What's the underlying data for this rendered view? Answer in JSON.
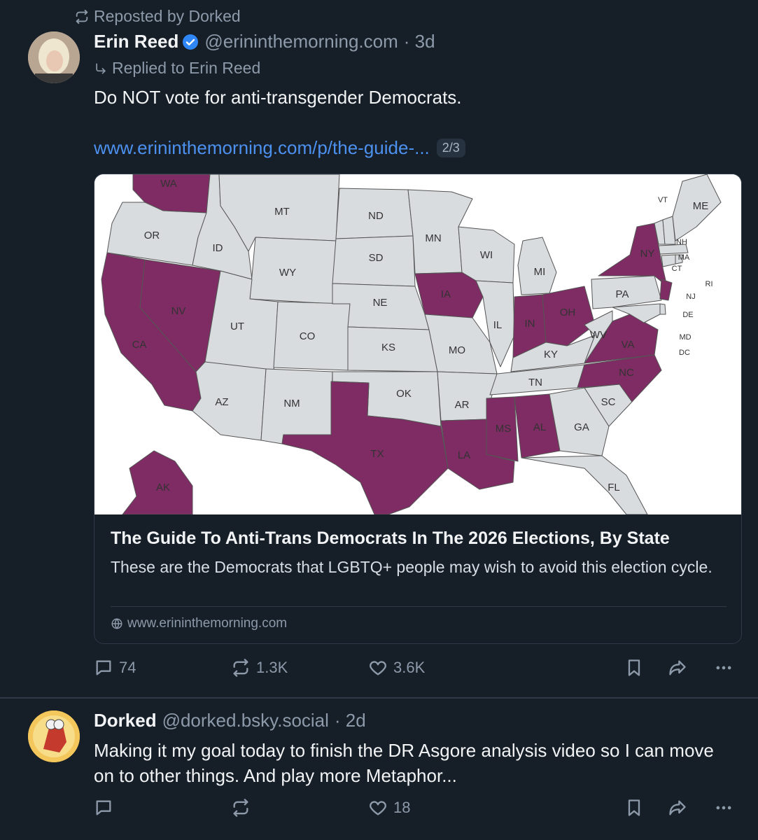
{
  "repost": {
    "label": "Reposted by Dorked"
  },
  "post1": {
    "author": "Erin Reed",
    "handle": "@erininthemorning.com",
    "time": "· 3d",
    "replied_to": "Replied to Erin Reed",
    "text": "Do NOT vote for anti-transgender Democrats.",
    "link": "www.erininthemorning.com/p/the-guide-...",
    "thread_badge": "2/3",
    "card": {
      "title": "The Guide To Anti-Trans Democrats In The 2026 Elections, By State",
      "description": "These are the Democrats that LGBTQ+ people may wish to avoid this election cycle.",
      "domain": "www.erininthemorning.com"
    },
    "replies": "74",
    "reposts": "1.3K",
    "likes": "3.6K"
  },
  "map": {
    "highlight_color": "#7e2c63",
    "base_color": "#d9dcdf",
    "highlighted_states": [
      "WA",
      "CA",
      "NV",
      "IA",
      "IN",
      "OH",
      "NY",
      "NJ",
      "VA",
      "NC",
      "TX",
      "LA",
      "MS",
      "AL",
      "AK"
    ],
    "labels": {
      "WA": "WA",
      "OR": "OR",
      "CA": "CA",
      "NV": "NV",
      "ID": "ID",
      "MT": "MT",
      "WY": "WY",
      "UT": "UT",
      "AZ": "AZ",
      "CO": "CO",
      "NM": "NM",
      "ND": "ND",
      "SD": "SD",
      "NE": "NE",
      "KS": "KS",
      "OK": "OK",
      "TX": "TX",
      "MN": "MN",
      "IA": "IA",
      "MO": "MO",
      "AR": "AR",
      "LA": "LA",
      "WI": "WI",
      "IL": "IL",
      "MI": "MI",
      "IN": "IN",
      "OH": "OH",
      "KY": "KY",
      "TN": "TN",
      "MS": "MS",
      "AL": "AL",
      "GA": "GA",
      "FL": "FL",
      "SC": "SC",
      "NC": "NC",
      "VA": "VA",
      "WV": "WV",
      "PA": "PA",
      "NY": "NY",
      "VT": "VT",
      "ME": "ME",
      "NH": "NH",
      "MA": "MA",
      "CT": "CT",
      "RI": "RI",
      "NJ": "NJ",
      "DE": "DE",
      "MD": "MD",
      "DC": "DC",
      "AK": "AK"
    }
  },
  "post2": {
    "author": "Dorked",
    "handle": "@dorked.bsky.social",
    "time": "· 2d",
    "text": "Making it my goal today to finish the DR Asgore analysis video so I can move on to other things. And play more Metaphor...",
    "replies": "",
    "reposts": "",
    "likes": "18"
  },
  "icons": [
    "repost-icon",
    "verified-icon",
    "reply-arrow-icon",
    "comment-icon",
    "like-icon",
    "bookmark-icon",
    "share-icon",
    "more-icon",
    "globe-icon"
  ]
}
